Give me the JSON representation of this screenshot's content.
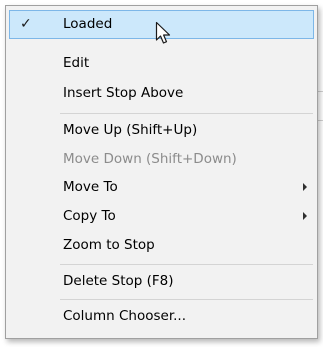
{
  "context_menu": {
    "items": [
      {
        "label": "Loaded",
        "checked": true,
        "highlighted": true
      },
      {
        "label": "Edit"
      },
      {
        "label": "Insert Stop Above"
      },
      {
        "label": "Move Up (Shift+Up)"
      },
      {
        "label": "Move Down (Shift+Down)",
        "disabled": true
      },
      {
        "label": "Move To",
        "submenu": true
      },
      {
        "label": "Copy To",
        "submenu": true
      },
      {
        "label": "Zoom to Stop"
      },
      {
        "label": "Delete Stop (F8)"
      },
      {
        "label": "Column Chooser..."
      }
    ],
    "check_glyph": "✓"
  },
  "colors": {
    "highlight_fill": "#cce8fb",
    "highlight_border": "#7db7e8",
    "menu_background": "#f2f2f2",
    "disabled_text": "#8c8c8c"
  }
}
